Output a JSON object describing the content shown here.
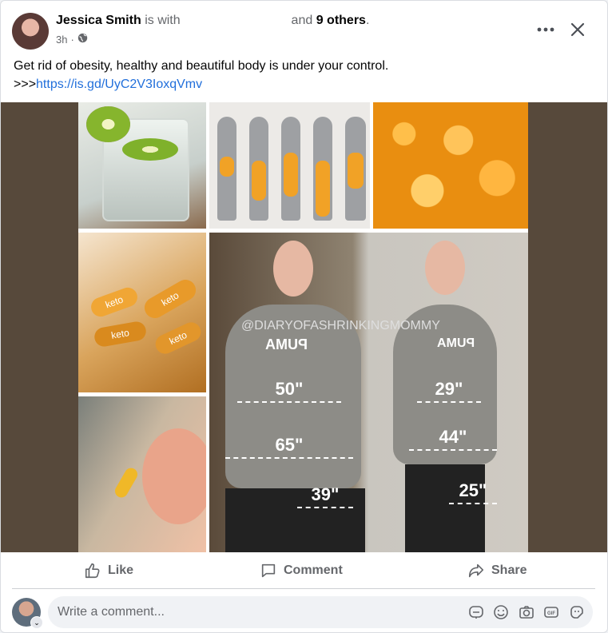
{
  "post": {
    "author": "Jessica Smith",
    "with_text": "is with",
    "and_text": "and",
    "others_text": "9 others",
    "period": ".",
    "time": "3h",
    "dot": "·",
    "text_line1": "Get rid of obesity, healthy and beautiful body is under your control.",
    "text_prefix": ">>>",
    "link": "https://is.gd/UyC2V3IoxqVmv"
  },
  "image": {
    "watermark": "@DIARYOFASHRINKINGMOMMY",
    "brand_left": "PUMA",
    "brand_right": "PUMA",
    "before": [
      "50\"",
      "65\"",
      "39\""
    ],
    "after": [
      "29\"",
      "44\"",
      "25\""
    ],
    "capsule_labels": [
      "keto",
      "keto",
      "keto",
      "keto"
    ]
  },
  "actions": {
    "like": "Like",
    "comment": "Comment",
    "share": "Share"
  },
  "comment_box": {
    "placeholder": "Write a comment..."
  },
  "icons": {
    "privacy": "globe-icon",
    "more": "more-horizontal-icon",
    "close": "close-icon",
    "like": "thumbs-up-icon",
    "comment": "comment-bubble-icon",
    "share": "share-arrow-icon",
    "input_icons": [
      "avatar-sticker-icon",
      "emoji-icon",
      "camera-icon",
      "gif-icon",
      "sticker-icon"
    ]
  },
  "colors": {
    "link": "#216fdb",
    "media_bg": "#57493b",
    "fat_orange": "#f1a226"
  }
}
